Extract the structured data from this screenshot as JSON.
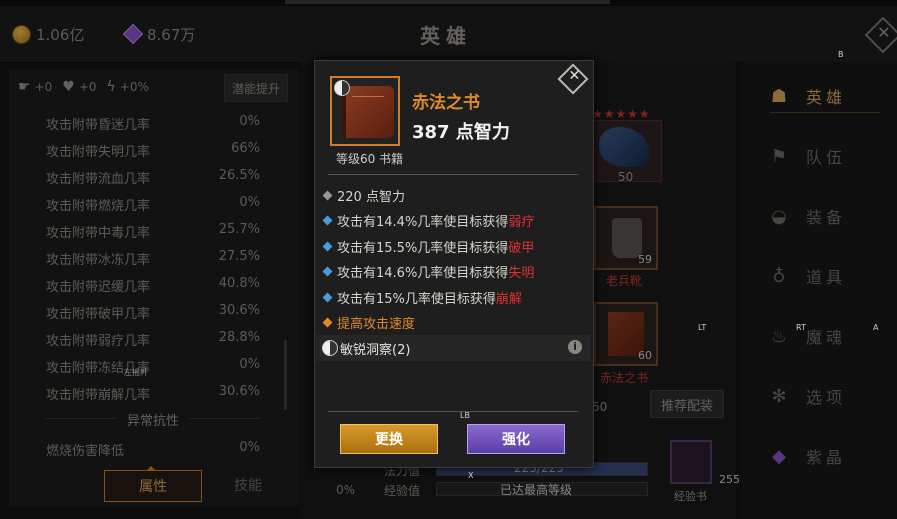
{
  "header": {
    "title": "英雄",
    "gold": "1.06亿",
    "gems": "8.67万",
    "close_label": "✕"
  },
  "left": {
    "chips": [
      "+0",
      "+0",
      "+0%"
    ],
    "potential_label": "潜能提升",
    "stats": [
      {
        "label": "攻击附带昏迷几率",
        "value": "0%"
      },
      {
        "label": "攻击附带失明几率",
        "value": "66%"
      },
      {
        "label": "攻击附带流血几率",
        "value": "26.5%"
      },
      {
        "label": "攻击附带燃烧几率",
        "value": "0%"
      },
      {
        "label": "攻击附带中毒几率",
        "value": "25.7%"
      },
      {
        "label": "攻击附带冰冻几率",
        "value": "27.5%"
      },
      {
        "label": "攻击附带迟缓几率",
        "value": "40.8%"
      },
      {
        "label": "攻击附带破甲几率",
        "value": "30.6%"
      },
      {
        "label": "攻击附带弱疗几率",
        "value": "28.8%"
      },
      {
        "label": "攻击附带冻结几率",
        "value": "0%"
      },
      {
        "label": "攻击附带崩解几率",
        "value": "30.6%"
      }
    ],
    "section_title": "异常抗性",
    "resist": {
      "label": "燃烧伤害降低",
      "value": "0%"
    },
    "tabs": [
      "属性",
      "技能"
    ],
    "hint": "左摇杆"
  },
  "middle": {
    "stars": "★★★★★",
    "hero_level": "50",
    "boots_level": "59",
    "boots_name": "老兵靴",
    "book_level": "60",
    "book_name": "赤法之书",
    "partial_num": "50",
    "recommend_label": "推荐配装",
    "mana_label": "法力值",
    "mana_value": "225/225",
    "exp_label": "经验值",
    "exp_value": "已达最高等级",
    "percent": "0%",
    "expbook_count": "255",
    "expbook_name": "经验书"
  },
  "nav": {
    "items": [
      {
        "label": "英雄",
        "icon": "hero-icon",
        "active": true
      },
      {
        "label": "队伍",
        "icon": "flag-icon"
      },
      {
        "label": "装备",
        "icon": "helmet-icon"
      },
      {
        "label": "道具",
        "icon": "bag-icon"
      },
      {
        "label": "魔魂",
        "icon": "flame-icon"
      },
      {
        "label": "选项",
        "icon": "gear-icon"
      },
      {
        "label": "紫晶",
        "icon": "crystal-icon"
      }
    ]
  },
  "popup": {
    "name": "赤法之书",
    "main_stat": "387 点智力",
    "level": "等级60 书籍",
    "attrs": [
      {
        "text": "220 点智力",
        "tag": "",
        "color": "#9a968e"
      },
      {
        "text": "攻击有14.4%几率使目标获得",
        "tag": "弱疗",
        "color": "#4a9ae0"
      },
      {
        "text": "攻击有15.5%几率使目标获得",
        "tag": "破甲",
        "color": "#4a9ae0"
      },
      {
        "text": "攻击有14.6%几率使目标获得",
        "tag": "失明",
        "color": "#4a9ae0"
      },
      {
        "text": "攻击有15%几率使目标获得",
        "tag": "崩解",
        "color": "#4a9ae0"
      },
      {
        "text": "提高攻击速度",
        "tag": "",
        "color": "#e08a2e"
      }
    ],
    "set_name": "敏锐洞察(2)",
    "replace_label": "更换",
    "enhance_label": "强化",
    "info_label": "i"
  },
  "controller_hints": {
    "b": "B",
    "a": "A",
    "x": "X",
    "lb": "LB",
    "lt": "LT",
    "rt": "RT"
  },
  "colors": {
    "accent": "#d9a457",
    "debuff": "#e03030",
    "rarity": "#e08a2e"
  }
}
